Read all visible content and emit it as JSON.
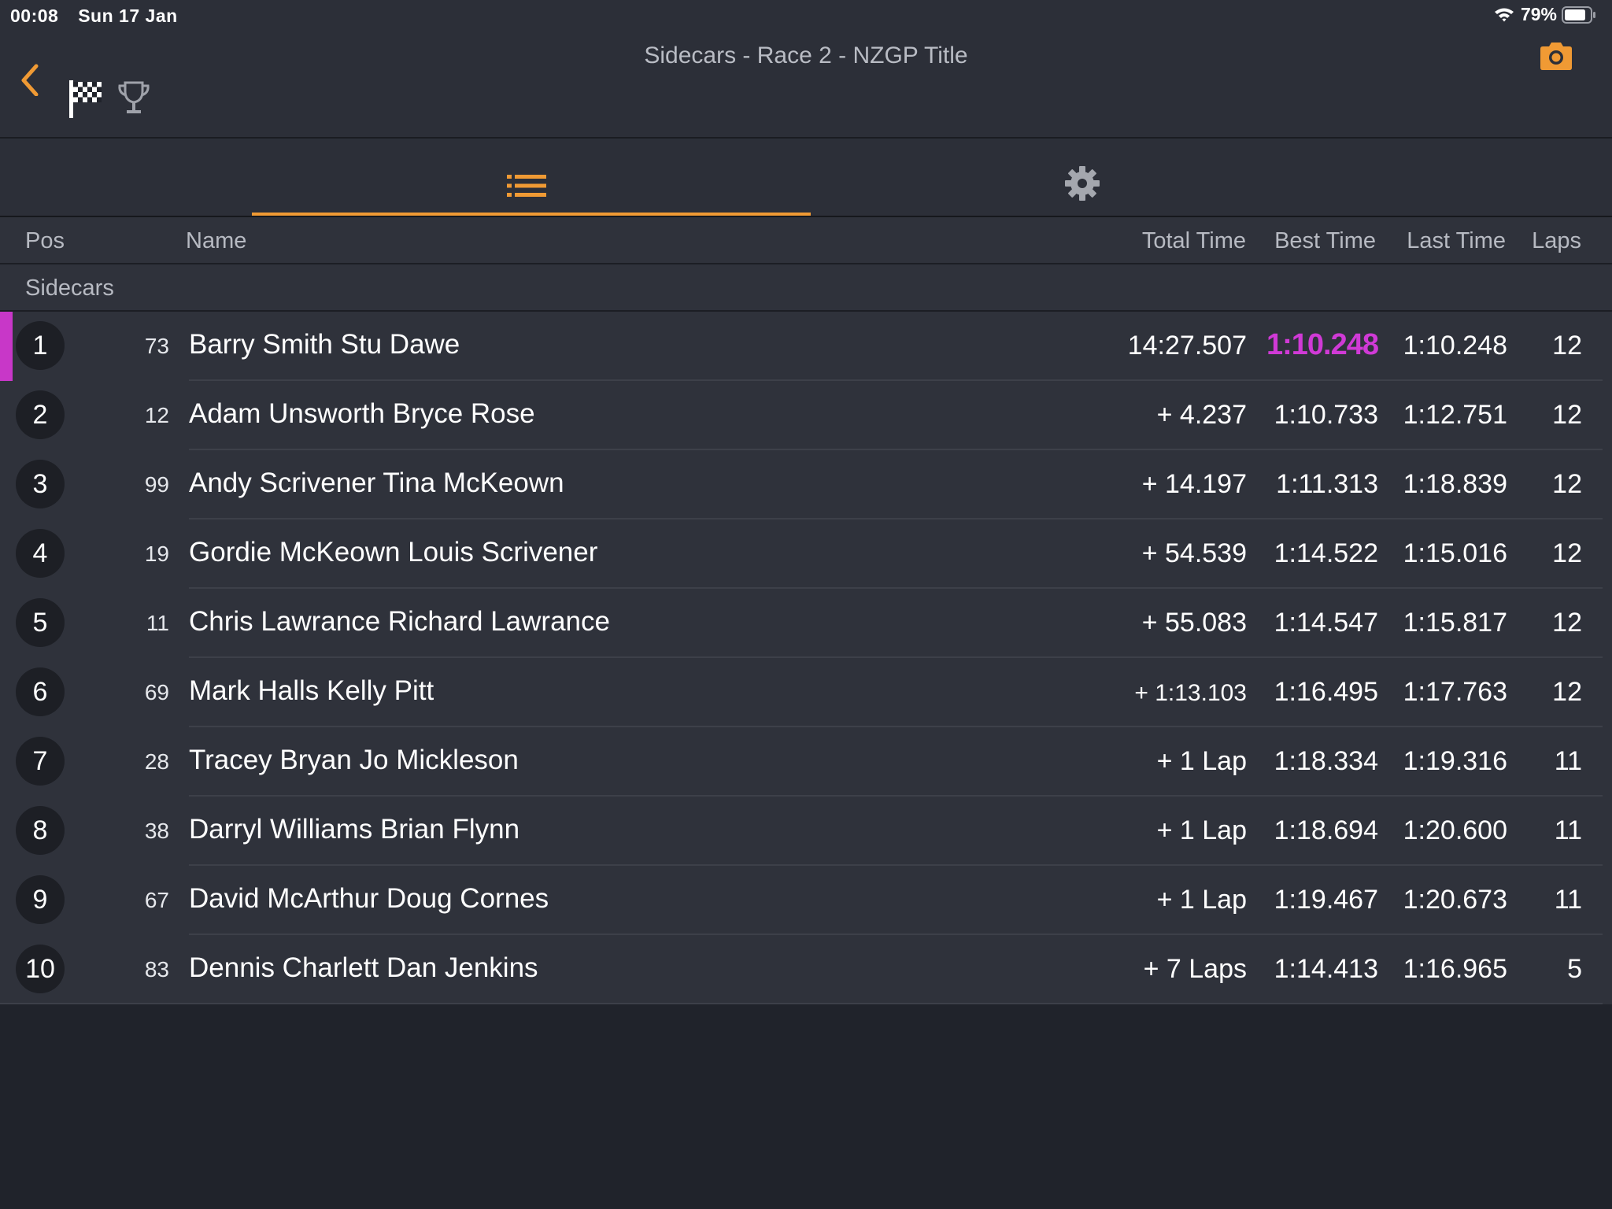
{
  "status_bar": {
    "time": "00:08",
    "date": "Sun 17 Jan",
    "battery": "79%"
  },
  "nav": {
    "title": "Sidecars - Race 2 - NZGP Title",
    "accent_color": "#f09a34"
  },
  "tabs": [
    {
      "name": "list",
      "icon": "list-icon",
      "selected": true
    },
    {
      "name": "settings",
      "icon": "gear-icon",
      "selected": false
    }
  ],
  "columns": {
    "pos": "Pos",
    "name": "Name",
    "total": "Total Time",
    "best": "Best Time",
    "last": "Last Time",
    "laps": "Laps"
  },
  "group": "Sidecars",
  "fastest_lap_color": "#d03ad6",
  "rows": [
    {
      "pos": "1",
      "num": "73",
      "name": "Barry Smith Stu Dawe",
      "total": "14:27.507",
      "best": "1:10.248",
      "last": "1:10.248",
      "laps": "12"
    },
    {
      "pos": "2",
      "num": "12",
      "name": "Adam Unsworth Bryce Rose",
      "total": "+ 4.237",
      "best": "1:10.733",
      "last": "1:12.751",
      "laps": "12"
    },
    {
      "pos": "3",
      "num": "99",
      "name": "Andy Scrivener Tina McKeown",
      "total": "+ 14.197",
      "best": "1:11.313",
      "last": "1:18.839",
      "laps": "12"
    },
    {
      "pos": "4",
      "num": "19",
      "name": "Gordie McKeown Louis Scrivener",
      "total": "+ 54.539",
      "best": "1:14.522",
      "last": "1:15.016",
      "laps": "12"
    },
    {
      "pos": "5",
      "num": "11",
      "name": "Chris Lawrance Richard Lawrance",
      "total": "+ 55.083",
      "best": "1:14.547",
      "last": "1:15.817",
      "laps": "12"
    },
    {
      "pos": "6",
      "num": "69",
      "name": "Mark Halls Kelly Pitt",
      "total": "+ 1:13.103",
      "best": "1:16.495",
      "last": "1:17.763",
      "laps": "12"
    },
    {
      "pos": "7",
      "num": "28",
      "name": "Tracey Bryan Jo Mickleson",
      "total": "+ 1 Lap",
      "best": "1:18.334",
      "last": "1:19.316",
      "laps": "11"
    },
    {
      "pos": "8",
      "num": "38",
      "name": "Darryl Williams Brian Flynn",
      "total": "+ 1 Lap",
      "best": "1:18.694",
      "last": "1:20.600",
      "laps": "11"
    },
    {
      "pos": "9",
      "num": "67",
      "name": "David McArthur Doug Cornes",
      "total": "+ 1 Lap",
      "best": "1:19.467",
      "last": "1:20.673",
      "laps": "11"
    },
    {
      "pos": "10",
      "num": "83",
      "name": "Dennis Charlett Dan Jenkins",
      "total": "+ 7 Laps",
      "best": "1:14.413",
      "last": "1:16.965",
      "laps": "5"
    }
  ]
}
